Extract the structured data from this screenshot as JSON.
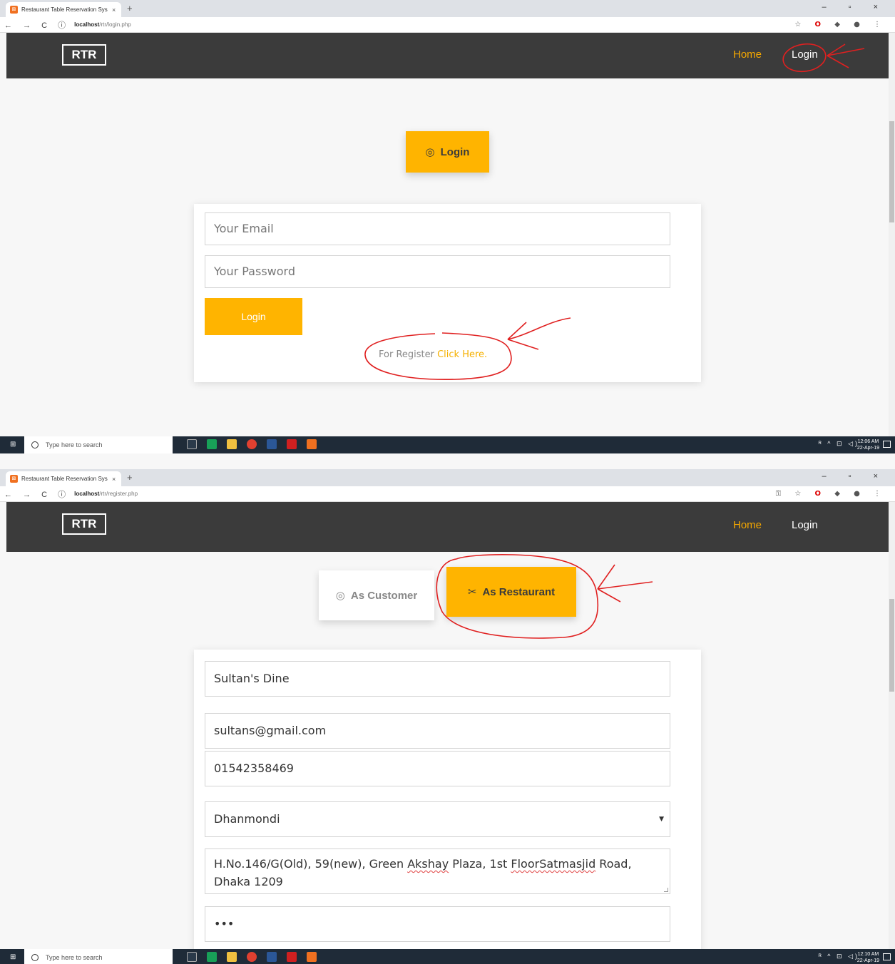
{
  "shot1": {
    "browser": {
      "tab_title": "Restaurant Table Reservation Sys",
      "tab_close": "×",
      "new_tab": "+",
      "window_controls": "–  ▫  ×",
      "nav_buttons": "← → C ⓘ",
      "url_host": "localhost",
      "url_path": "/rtr/login.php"
    },
    "navbar": {
      "brand": "RTR",
      "home": "Home",
      "login": "Login"
    },
    "page": {
      "login_button": "Login",
      "email_placeholder": "Your Email",
      "password_placeholder": "Your Password",
      "submit_label": "Login",
      "register_prefix": "For Register",
      "register_link": "Click Here."
    },
    "taskbar": {
      "search_placeholder": "Type here to search",
      "time": "12:06 AM",
      "date": "22-Apr-19"
    }
  },
  "shot2": {
    "browser": {
      "tab_title": "Restaurant Table Reservation Sys",
      "tab_close": "×",
      "new_tab": "+",
      "window_controls": "–  ▫  ×",
      "nav_buttons": "← → C ⓘ",
      "url_host": "localhost",
      "url_path": "/rtr/register.php"
    },
    "navbar": {
      "brand": "RTR",
      "home": "Home",
      "login": "Login"
    },
    "page": {
      "tab_customer": "As Customer",
      "tab_restaurant": "As Restaurant",
      "name_value": "Sultan's Dine",
      "email_value": "sultans@gmail.com",
      "phone_value": "01542358469",
      "area_value": "Dhanmondi",
      "address_before_1": "H.No.146/G(Old), 59(new), Green ",
      "address_sq_1": "Akshay",
      "address_mid": " Plaza, 1st ",
      "address_sq_2": "FloorSatmasjid",
      "address_after": " Road, Dhaka 1209",
      "password_value": "•••"
    },
    "taskbar": {
      "search_placeholder": "Type here to search",
      "time": "12:10 AM",
      "date": "22-Apr-19"
    }
  },
  "colors": {
    "accent": "#ffb400",
    "navbar": "#3b3b3b",
    "annotation": "#e02020"
  },
  "icons": [
    "steak-icon",
    "fork-knife-icon",
    "search-icon",
    "windows-start-icon"
  ]
}
